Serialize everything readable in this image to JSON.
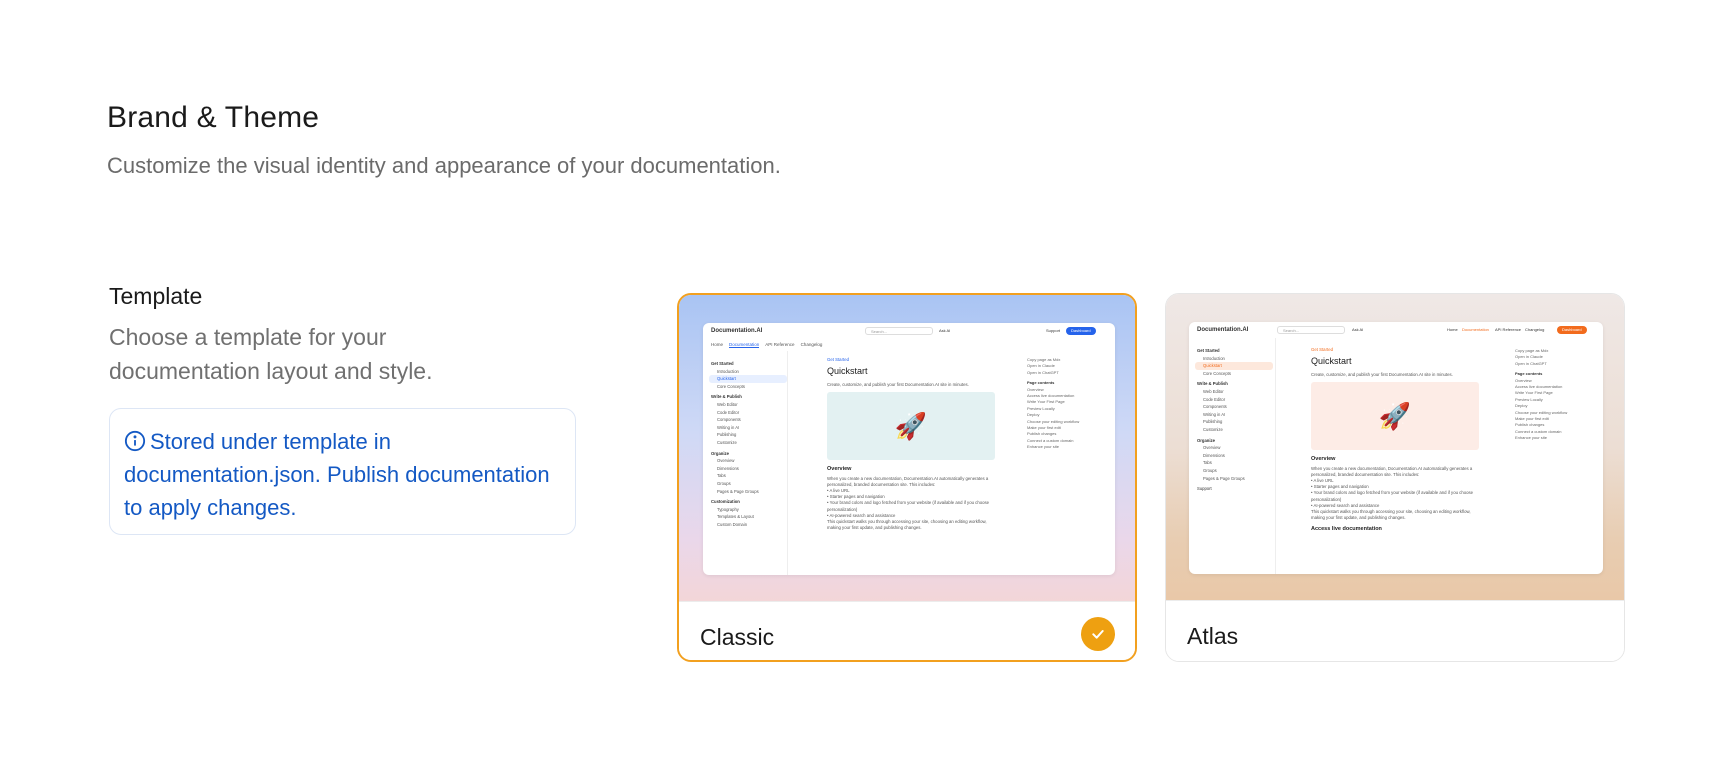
{
  "header": {
    "title": "Brand & Theme",
    "subtitle": "Customize the visual identity and appearance of your documentation."
  },
  "template_section": {
    "title": "Template",
    "description": "Choose a template for your documentation layout and style.",
    "info": "Stored under template in documentation.json. Publish documentation to apply changes.",
    "info_icon": "info-circle-icon",
    "options": [
      {
        "label": "Classic",
        "selected": true
      },
      {
        "label": "Atlas",
        "selected": false
      }
    ]
  },
  "preview": {
    "brand": "Documentation.AI",
    "search_placeholder": "Search...",
    "search_shortcut": "Ctrl K",
    "ask_ai": "Ask AI",
    "support": "Support",
    "dashboard": "Dashboard",
    "nav": [
      "Home",
      "Documentation",
      "API Reference",
      "Changelog"
    ],
    "breadcrumb": "Get Started",
    "page_title": "Quickstart",
    "page_lead": "Create, customize, and publish your first Documentation.AI site in minutes.",
    "overview_heading": "Overview",
    "overview_text": "When you create a new documentation, Documentation.AI automatically generates a personalized, branded documentation site. This includes:",
    "bullets": [
      "A live URL",
      "Starter pages and navigation",
      "Your brand colors and logo fetched from your website (if available and if you choose personalization)",
      "AI-powered search and assistance"
    ],
    "closing_text": "This quickstart walks you through accessing your site, choosing an editing workflow, making your first update, and publishing changes.",
    "access_heading": "Access live documentation",
    "sidebar_groups": [
      {
        "title": "Get Started",
        "items": [
          "Introduction",
          "Quickstart",
          "Core Concepts"
        ]
      },
      {
        "title": "Write & Publish",
        "items": [
          "Web Editor",
          "Code Editor",
          "Components",
          "Writing in AI",
          "Publishing",
          "Customize"
        ]
      },
      {
        "title": "Organize",
        "items": [
          "Overview",
          "Dimensions",
          "Tabs",
          "Groups",
          "Pages & Page Groups"
        ]
      },
      {
        "title": "Customization",
        "items": [
          "Typography",
          "Templates & Layout",
          "Custom Domain"
        ]
      }
    ],
    "toc_actions": [
      "Copy page as Mdx",
      "Open in Claude",
      "Open in ChatGPT"
    ],
    "toc_heading": "Page contents",
    "toc_items": [
      "Overview",
      "Access live documentation",
      "Write Your First Page",
      "Preview Locally",
      "Deploy",
      "Choose your editing workflow",
      "Make your first edit",
      "Publish changes",
      "Connect a custom domain",
      "Enhance your site"
    ]
  },
  "colors": {
    "accent_orange": "#f2a01f",
    "info_blue": "#1459c4",
    "classic_primary": "#2563eb",
    "atlas_primary": "#f26b1d"
  }
}
